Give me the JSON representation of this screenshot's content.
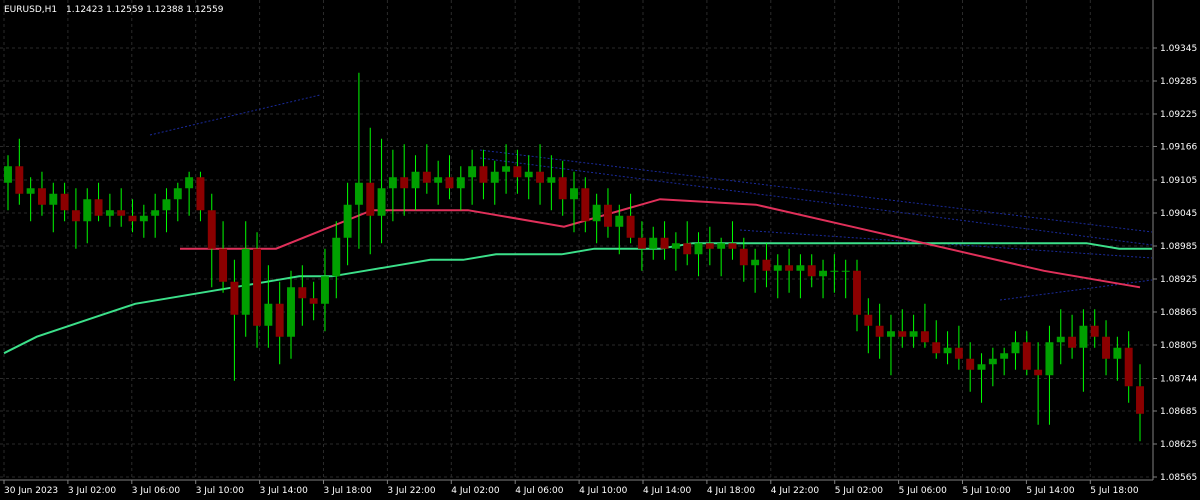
{
  "chart_data": {
    "type": "candlestick",
    "symbol_label": "EURUSD,H1",
    "ohlc_label": "1.12423 1.12559 1.12388 1.12559",
    "ylim": [
      1.08565,
      1.09385
    ],
    "y_ticks": [
      "1.09345",
      "1.09285",
      "1.09225",
      "1.09166",
      "1.09105",
      "1.09045",
      "1.08985",
      "1.08925",
      "1.08865",
      "1.08805",
      "1.08744",
      "1.08685",
      "1.08625",
      "1.08565"
    ],
    "x_ticks": [
      "30 Jun 2023",
      "3 Jul 02:00",
      "3 Jul 06:00",
      "3 Jul 10:00",
      "3 Jul 14:00",
      "3 Jul 18:00",
      "3 Jul 22:00",
      "4 Jul 02:00",
      "4 Jul 06:00",
      "4 Jul 10:00",
      "4 Jul 14:00",
      "4 Jul 18:00",
      "4 Jul 22:00",
      "5 Jul 02:00",
      "5 Jul 06:00",
      "5 Jul 10:00",
      "5 Jul 14:00",
      "5 Jul 18:00"
    ],
    "candles": [
      {
        "o": 1.091,
        "h": 1.0915,
        "l": 1.0905,
        "c": 1.0913
      },
      {
        "o": 1.0913,
        "h": 1.0918,
        "l": 1.0906,
        "c": 1.0908
      },
      {
        "o": 1.0908,
        "h": 1.0911,
        "l": 1.0903,
        "c": 1.0909
      },
      {
        "o": 1.0909,
        "h": 1.0912,
        "l": 1.0904,
        "c": 1.0906
      },
      {
        "o": 1.0906,
        "h": 1.091,
        "l": 1.0901,
        "c": 1.0908
      },
      {
        "o": 1.0908,
        "h": 1.091,
        "l": 1.0903,
        "c": 1.0905
      },
      {
        "o": 1.0905,
        "h": 1.0909,
        "l": 1.0898,
        "c": 1.0903
      },
      {
        "o": 1.0903,
        "h": 1.0909,
        "l": 1.0899,
        "c": 1.0907
      },
      {
        "o": 1.0907,
        "h": 1.091,
        "l": 1.0903,
        "c": 1.0904
      },
      {
        "o": 1.0904,
        "h": 1.0908,
        "l": 1.0902,
        "c": 1.0905
      },
      {
        "o": 1.0905,
        "h": 1.0909,
        "l": 1.0902,
        "c": 1.0904
      },
      {
        "o": 1.0904,
        "h": 1.0907,
        "l": 1.0901,
        "c": 1.0903
      },
      {
        "o": 1.0903,
        "h": 1.0906,
        "l": 1.09,
        "c": 1.0904
      },
      {
        "o": 1.0904,
        "h": 1.0908,
        "l": 1.09,
        "c": 1.0905
      },
      {
        "o": 1.0905,
        "h": 1.0909,
        "l": 1.0901,
        "c": 1.0907
      },
      {
        "o": 1.0907,
        "h": 1.091,
        "l": 1.0903,
        "c": 1.0909
      },
      {
        "o": 1.0909,
        "h": 1.0912,
        "l": 1.0904,
        "c": 1.0911
      },
      {
        "o": 1.0911,
        "h": 1.0912,
        "l": 1.0903,
        "c": 1.0905
      },
      {
        "o": 1.0905,
        "h": 1.0908,
        "l": 1.0891,
        "c": 1.0898
      },
      {
        "o": 1.0898,
        "h": 1.0903,
        "l": 1.089,
        "c": 1.0892
      },
      {
        "o": 1.0892,
        "h": 1.0896,
        "l": 1.0874,
        "c": 1.0886
      },
      {
        "o": 1.0886,
        "h": 1.0903,
        "l": 1.0882,
        "c": 1.0898
      },
      {
        "o": 1.0898,
        "h": 1.0901,
        "l": 1.088,
        "c": 1.0884
      },
      {
        "o": 1.0884,
        "h": 1.0895,
        "l": 1.088,
        "c": 1.0888
      },
      {
        "o": 1.0888,
        "h": 1.0892,
        "l": 1.0877,
        "c": 1.0882
      },
      {
        "o": 1.0882,
        "h": 1.0894,
        "l": 1.0878,
        "c": 1.0891
      },
      {
        "o": 1.0891,
        "h": 1.0895,
        "l": 1.0884,
        "c": 1.0889
      },
      {
        "o": 1.0889,
        "h": 1.0892,
        "l": 1.0885,
        "c": 1.0888
      },
      {
        "o": 1.0888,
        "h": 1.0898,
        "l": 1.0883,
        "c": 1.0893
      },
      {
        "o": 1.0893,
        "h": 1.0903,
        "l": 1.0889,
        "c": 1.09
      },
      {
        "o": 1.09,
        "h": 1.091,
        "l": 1.0895,
        "c": 1.0906
      },
      {
        "o": 1.0906,
        "h": 1.093,
        "l": 1.0898,
        "c": 1.091
      },
      {
        "o": 1.091,
        "h": 1.092,
        "l": 1.0897,
        "c": 1.0904
      },
      {
        "o": 1.0904,
        "h": 1.0918,
        "l": 1.0899,
        "c": 1.0909
      },
      {
        "o": 1.0909,
        "h": 1.0916,
        "l": 1.0903,
        "c": 1.0911
      },
      {
        "o": 1.0911,
        "h": 1.0917,
        "l": 1.0904,
        "c": 1.0909
      },
      {
        "o": 1.0909,
        "h": 1.0915,
        "l": 1.0905,
        "c": 1.0912
      },
      {
        "o": 1.0912,
        "h": 1.0917,
        "l": 1.0908,
        "c": 1.091
      },
      {
        "o": 1.091,
        "h": 1.0914,
        "l": 1.0906,
        "c": 1.0911
      },
      {
        "o": 1.0911,
        "h": 1.0915,
        "l": 1.0907,
        "c": 1.0909
      },
      {
        "o": 1.0909,
        "h": 1.0913,
        "l": 1.0905,
        "c": 1.0911
      },
      {
        "o": 1.0911,
        "h": 1.0916,
        "l": 1.0906,
        "c": 1.0913
      },
      {
        "o": 1.0913,
        "h": 1.0916,
        "l": 1.0907,
        "c": 1.091
      },
      {
        "o": 1.091,
        "h": 1.0914,
        "l": 1.0906,
        "c": 1.0912
      },
      {
        "o": 1.0912,
        "h": 1.0917,
        "l": 1.0908,
        "c": 1.0913
      },
      {
        "o": 1.0913,
        "h": 1.0916,
        "l": 1.0908,
        "c": 1.0911
      },
      {
        "o": 1.0911,
        "h": 1.0915,
        "l": 1.0907,
        "c": 1.0912
      },
      {
        "o": 1.0912,
        "h": 1.0917,
        "l": 1.0906,
        "c": 1.091
      },
      {
        "o": 1.091,
        "h": 1.0915,
        "l": 1.0905,
        "c": 1.0911
      },
      {
        "o": 1.0911,
        "h": 1.0914,
        "l": 1.0904,
        "c": 1.0907
      },
      {
        "o": 1.0907,
        "h": 1.0912,
        "l": 1.0901,
        "c": 1.0909
      },
      {
        "o": 1.0909,
        "h": 1.0911,
        "l": 1.0901,
        "c": 1.0903
      },
      {
        "o": 1.0903,
        "h": 1.0908,
        "l": 1.0899,
        "c": 1.0906
      },
      {
        "o": 1.0906,
        "h": 1.0909,
        "l": 1.09,
        "c": 1.0902
      },
      {
        "o": 1.0902,
        "h": 1.0906,
        "l": 1.0897,
        "c": 1.0904
      },
      {
        "o": 1.0904,
        "h": 1.0908,
        "l": 1.0899,
        "c": 1.09
      },
      {
        "o": 1.09,
        "h": 1.0903,
        "l": 1.0894,
        "c": 1.0898
      },
      {
        "o": 1.0898,
        "h": 1.0902,
        "l": 1.0896,
        "c": 1.09
      },
      {
        "o": 1.09,
        "h": 1.0903,
        "l": 1.0896,
        "c": 1.0898
      },
      {
        "o": 1.0898,
        "h": 1.0901,
        "l": 1.0894,
        "c": 1.0899
      },
      {
        "o": 1.0899,
        "h": 1.0903,
        "l": 1.0895,
        "c": 1.0897
      },
      {
        "o": 1.0897,
        "h": 1.0901,
        "l": 1.0893,
        "c": 1.0899
      },
      {
        "o": 1.0899,
        "h": 1.0902,
        "l": 1.0895,
        "c": 1.0898
      },
      {
        "o": 1.0898,
        "h": 1.09,
        "l": 1.0893,
        "c": 1.0899
      },
      {
        "o": 1.0899,
        "h": 1.0903,
        "l": 1.0896,
        "c": 1.0898
      },
      {
        "o": 1.0898,
        "h": 1.09,
        "l": 1.0892,
        "c": 1.0895
      },
      {
        "o": 1.0895,
        "h": 1.0898,
        "l": 1.089,
        "c": 1.0896
      },
      {
        "o": 1.0896,
        "h": 1.0899,
        "l": 1.0891,
        "c": 1.0894
      },
      {
        "o": 1.0894,
        "h": 1.0897,
        "l": 1.0889,
        "c": 1.0895
      },
      {
        "o": 1.0895,
        "h": 1.0898,
        "l": 1.089,
        "c": 1.0894
      },
      {
        "o": 1.0894,
        "h": 1.0897,
        "l": 1.0889,
        "c": 1.0895
      },
      {
        "o": 1.0895,
        "h": 1.0897,
        "l": 1.0891,
        "c": 1.0893
      },
      {
        "o": 1.0893,
        "h": 1.0896,
        "l": 1.0889,
        "c": 1.0894
      },
      {
        "o": 1.0894,
        "h": 1.0897,
        "l": 1.089,
        "c": 1.0894
      },
      {
        "o": 1.0894,
        "h": 1.0896,
        "l": 1.0889,
        "c": 1.0894
      },
      {
        "o": 1.0894,
        "h": 1.0896,
        "l": 1.0883,
        "c": 1.0886
      },
      {
        "o": 1.0886,
        "h": 1.0889,
        "l": 1.0879,
        "c": 1.0884
      },
      {
        "o": 1.0884,
        "h": 1.0888,
        "l": 1.0878,
        "c": 1.0882
      },
      {
        "o": 1.0882,
        "h": 1.0886,
        "l": 1.0875,
        "c": 1.0883
      },
      {
        "o": 1.0883,
        "h": 1.0887,
        "l": 1.088,
        "c": 1.0882
      },
      {
        "o": 1.0882,
        "h": 1.0886,
        "l": 1.088,
        "c": 1.0883
      },
      {
        "o": 1.0883,
        "h": 1.0888,
        "l": 1.088,
        "c": 1.0881
      },
      {
        "o": 1.0881,
        "h": 1.0885,
        "l": 1.0878,
        "c": 1.0879
      },
      {
        "o": 1.0879,
        "h": 1.0883,
        "l": 1.0877,
        "c": 1.088
      },
      {
        "o": 1.088,
        "h": 1.0884,
        "l": 1.0876,
        "c": 1.0878
      },
      {
        "o": 1.0878,
        "h": 1.0881,
        "l": 1.0872,
        "c": 1.0876
      },
      {
        "o": 1.0876,
        "h": 1.0879,
        "l": 1.087,
        "c": 1.0877
      },
      {
        "o": 1.0877,
        "h": 1.088,
        "l": 1.0873,
        "c": 1.0878
      },
      {
        "o": 1.0878,
        "h": 1.088,
        "l": 1.0875,
        "c": 1.0879
      },
      {
        "o": 1.0879,
        "h": 1.0883,
        "l": 1.0876,
        "c": 1.0881
      },
      {
        "o": 1.0881,
        "h": 1.0883,
        "l": 1.0875,
        "c": 1.0876
      },
      {
        "o": 1.0876,
        "h": 1.0881,
        "l": 1.0866,
        "c": 1.0875
      },
      {
        "o": 1.0875,
        "h": 1.0884,
        "l": 1.0866,
        "c": 1.0881
      },
      {
        "o": 1.0881,
        "h": 1.0887,
        "l": 1.0877,
        "c": 1.0882
      },
      {
        "o": 1.0882,
        "h": 1.0886,
        "l": 1.0878,
        "c": 1.088
      },
      {
        "o": 1.088,
        "h": 1.0887,
        "l": 1.0872,
        "c": 1.0884
      },
      {
        "o": 1.0884,
        "h": 1.0887,
        "l": 1.088,
        "c": 1.0882
      },
      {
        "o": 1.0882,
        "h": 1.0885,
        "l": 1.0875,
        "c": 1.0878
      },
      {
        "o": 1.0878,
        "h": 1.0882,
        "l": 1.0874,
        "c": 1.088
      },
      {
        "o": 1.088,
        "h": 1.0883,
        "l": 1.087,
        "c": 1.0873
      },
      {
        "o": 1.0873,
        "h": 1.0877,
        "l": 1.0863,
        "c": 1.0868
      }
    ],
    "ma_green": [
      1.0879,
      1.0882,
      1.0884,
      1.0886,
      1.0888,
      1.0889,
      1.089,
      1.0891,
      1.0892,
      1.0893,
      1.0893,
      1.0894,
      1.0895,
      1.0896,
      1.0896,
      1.0897,
      1.0897,
      1.0897,
      1.0898,
      1.0898,
      1.0898,
      1.0899,
      1.0899,
      1.0899,
      1.0899,
      1.0899,
      1.0899,
      1.0899,
      1.0899,
      1.0899,
      1.0899,
      1.0899,
      1.0899,
      1.0899,
      1.0898,
      1.0898
    ],
    "ma_red": [
      1.0898,
      1.0898,
      1.0905,
      1.0905,
      1.0902,
      1.0907,
      1.0906,
      1.0902,
      1.0898,
      1.0894,
      1.0891
    ],
    "colors": {
      "bull": "#00a000",
      "bear": "#8b0000",
      "wick_bull": "#00ff00",
      "grid": "#2a2a2a",
      "ma_green": "#3ce08a",
      "ma_red": "#e0305a",
      "trend_blue": "#1a2a9a"
    }
  }
}
